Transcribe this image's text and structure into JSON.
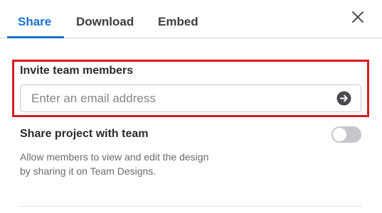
{
  "tabs": [
    {
      "label": "Share",
      "active": true
    },
    {
      "label": "Download",
      "active": false
    },
    {
      "label": "Embed",
      "active": false
    }
  ],
  "close_icon": "close-icon",
  "invite": {
    "title": "Invite team members",
    "email_placeholder": "Enter an email address",
    "email_value": "",
    "submit_icon": "arrow-right-circle-icon",
    "highlight_color": "#d81c22"
  },
  "share_project": {
    "title": "Share project with team",
    "toggle_on": false,
    "description_lines": [
      "Allow members to view and edit the design",
      "by sharing it on Team Designs."
    ]
  },
  "colors": {
    "accent": "#1872d4",
    "toggle_off": "#c6c6cb",
    "text_primary": "#2a2a2e",
    "text_secondary": "#6b6b72"
  }
}
